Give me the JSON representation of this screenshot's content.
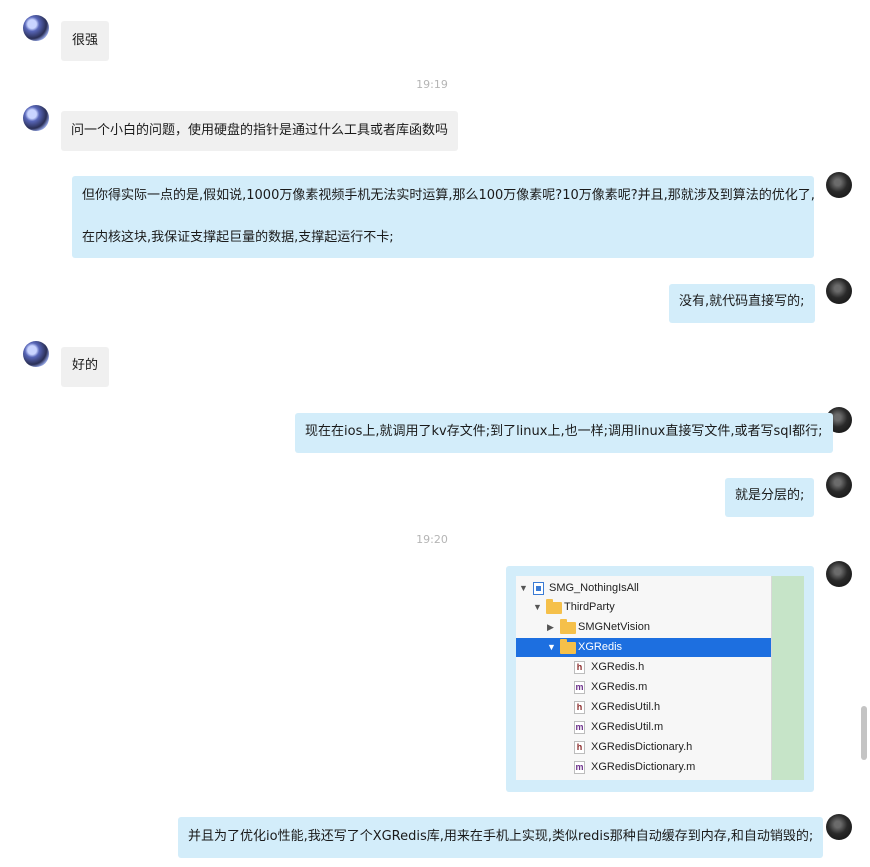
{
  "colors": {
    "incoming_bubble": "#f0f0f0",
    "outgoing_bubble": "#d3edfa",
    "timestamp": "#b5b5b5",
    "selection": "#1d6fe0"
  },
  "messages": {
    "m1": "很强",
    "ts1": "19:19",
    "m2": "问一个小白的问题，使用硬盘的指针是通过什么工具或者库函数吗",
    "m3_line1": "但你得实际一点的是,假如说,1000万像素视频手机无法实时运算,那么100万像素呢?10万像素呢?并且,那就涉及到算法的优化了,",
    "m3_line2": "在内核这块,我保证支撑起巨量的数据,支撑起运行不卡;",
    "m4": "没有,就代码直接写的;",
    "m5": "好的",
    "m6": "现在在ios上,就调用了kv存文件;到了linux上,也一样;调用linux直接写文件,或者写sql都行;",
    "m7": "就是分层的;",
    "ts2": "19:20",
    "m9": "并且为了优化io性能,我还写了个XGRedis库,用来在手机上实现,类似redis那种自动缓存到内存,和自动销毁的;"
  },
  "screenshot": {
    "tree": [
      {
        "label": "SMG_NothingIsAll",
        "icon": "project-icon"
      },
      {
        "label": "ThirdParty",
        "icon": "folder-icon"
      },
      {
        "label": "SMGNetVision",
        "icon": "folder-icon"
      },
      {
        "label": "XGRedis",
        "icon": "folder-icon"
      },
      {
        "label": "XGRedis.h",
        "icon": "h-file-icon",
        "badge": "h"
      },
      {
        "label": "XGRedis.m",
        "icon": "m-file-icon",
        "badge": "m"
      },
      {
        "label": "XGRedisUtil.h",
        "icon": "h-file-icon",
        "badge": "h"
      },
      {
        "label": "XGRedisUtil.m",
        "icon": "m-file-icon",
        "badge": "m"
      },
      {
        "label": "XGRedisDictionary.h",
        "icon": "h-file-icon",
        "badge": "h"
      },
      {
        "label": "XGRedisDictionary.m",
        "icon": "m-file-icon",
        "badge": "m"
      }
    ],
    "triangles": {
      "expanded": "▼",
      "collapsed": "▶"
    }
  }
}
